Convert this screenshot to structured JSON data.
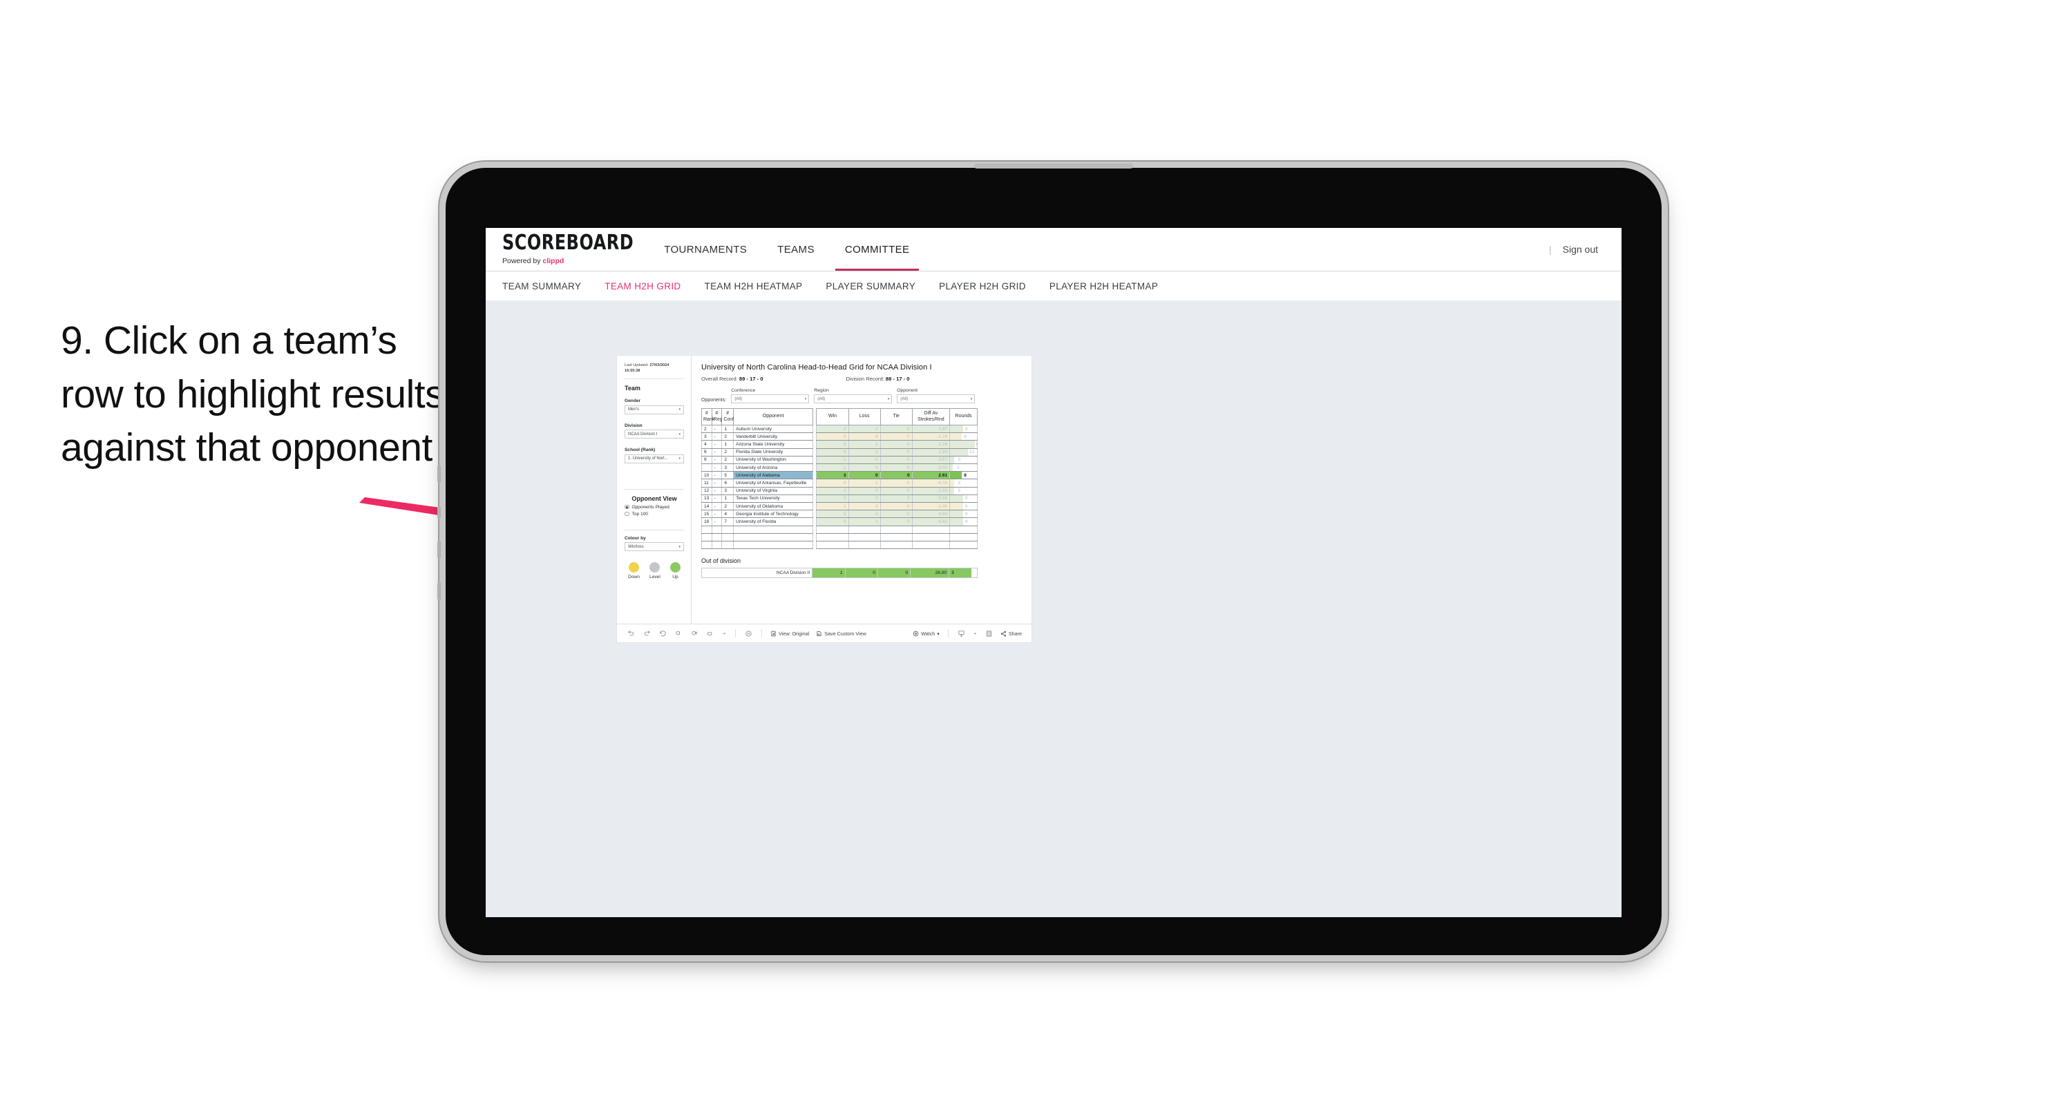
{
  "caption": {
    "text": "9. Click on a team’s row to highlight results against that opponent"
  },
  "app": {
    "brand": {
      "logo": "SCOREBOARD",
      "powered_prefix": "Powered by ",
      "powered_brand": "clippd"
    },
    "top_nav": [
      {
        "label": "TOURNAMENTS",
        "active": false
      },
      {
        "label": "TEAMS",
        "active": false
      },
      {
        "label": "COMMITTEE",
        "active": true
      }
    ],
    "sign_out": "Sign out",
    "sub_nav": [
      {
        "label": "TEAM SUMMARY",
        "active": false
      },
      {
        "label": "TEAM H2H GRID",
        "active": true
      },
      {
        "label": "TEAM H2H HEATMAP",
        "active": false
      },
      {
        "label": "PLAYER SUMMARY",
        "active": false
      },
      {
        "label": "PLAYER H2H GRID",
        "active": false
      },
      {
        "label": "PLAYER H2H HEATMAP",
        "active": false
      }
    ]
  },
  "sidebar": {
    "last_updated_label": "Last Updated: ",
    "last_updated_value": "27/03/2024 16:55:38",
    "team_heading": "Team",
    "gender": {
      "label": "Gender",
      "value": "Men’s"
    },
    "division": {
      "label": "Division",
      "value": "NCAA Division I"
    },
    "school": {
      "label": "School (Rank)",
      "value": "1. University of Nort..."
    },
    "opponent_view": {
      "heading": "Opponent View",
      "options": [
        {
          "label": "Opponents Played",
          "selected": true
        },
        {
          "label": "Top 100",
          "selected": false
        }
      ]
    },
    "colour_by": {
      "label": "Colour by",
      "value": "Win/loss"
    },
    "legend": [
      {
        "label": "Down",
        "color": "#f2d14b"
      },
      {
        "label": "Level",
        "color": "#c3c7ca"
      },
      {
        "label": "Up",
        "color": "#8bc963"
      }
    ]
  },
  "viz": {
    "title": "University of North Carolina Head-to-Head Grid for NCAA Division I",
    "overall_record_label": "Overall Record: ",
    "overall_record_value": "89 - 17 - 0",
    "division_record_label": "Division Record: ",
    "division_record_value": "88 - 17 - 0",
    "opponents_label": "Opponents:",
    "filters": [
      {
        "label": "Conference",
        "value": "(All)"
      },
      {
        "label": "Region",
        "value": "(All)"
      },
      {
        "label": "Opponent",
        "value": "(All)"
      }
    ],
    "columns": [
      "# Rank",
      "# Reg",
      "# Conf",
      "Opponent",
      "Win",
      "Loss",
      "Tie",
      "Diff Av Strokes/Rnd",
      "Rounds"
    ],
    "column_parts": {
      "rank_top": "#",
      "rank_bot": "Rank",
      "reg_top": "#",
      "reg_bot": "Reg",
      "conf_top": "#",
      "conf_bot": "Conf",
      "opponent": "Opponent",
      "win": "Win",
      "loss": "Loss",
      "tie": "Tie",
      "diff_top": "Diff Av",
      "diff_bot": "Strokes/Rnd",
      "rounds": "Rounds"
    },
    "rows": [
      {
        "rank": "2",
        "reg": "-",
        "conf": "1",
        "opponent": "Auburn University",
        "win": "2",
        "loss": "1",
        "tie": "0",
        "diff": "1.67",
        "rounds": "9",
        "rounds_pct": 48,
        "result": "win",
        "selected": false
      },
      {
        "rank": "3",
        "reg": "-",
        "conf": "2",
        "opponent": "Vanderbilt University",
        "win": "0",
        "loss": "4",
        "tie": "0",
        "diff": "-2.29",
        "rounds": "8",
        "rounds_pct": 43,
        "result": "loss",
        "selected": false
      },
      {
        "rank": "4",
        "reg": "-",
        "conf": "1",
        "opponent": "Arizona State University",
        "win": "5",
        "loss": "1",
        "tie": "0",
        "diff": "2.28",
        "rounds": "17",
        "rounds_pct": 92,
        "result": "win",
        "selected": false
      },
      {
        "rank": "6",
        "reg": "-",
        "conf": "2",
        "opponent": "Florida State University",
        "win": "4",
        "loss": "2",
        "tie": "0",
        "diff": "1.83",
        "rounds": "12",
        "rounds_pct": 66,
        "result": "win",
        "selected": false
      },
      {
        "rank": "8",
        "reg": "-",
        "conf": "2",
        "opponent": "University of Washington",
        "win": "1",
        "loss": "0",
        "tie": "0",
        "diff": "3.67",
        "rounds": "3",
        "rounds_pct": 16,
        "result": "win",
        "selected": false
      },
      {
        "rank": "",
        "reg": "-",
        "conf": "3",
        "opponent": "University of Arizona",
        "win": "1",
        "loss": "0",
        "tie": "0",
        "diff": "9.00",
        "rounds": "2",
        "rounds_pct": 11,
        "result": "win",
        "selected": false
      },
      {
        "rank": "10",
        "reg": "-",
        "conf": "5",
        "opponent": "University of Alabama",
        "win": "3",
        "loss": "0",
        "tie": "0",
        "diff": "2.61",
        "rounds": "8",
        "rounds_pct": 43,
        "result": "win",
        "selected": true
      },
      {
        "rank": "11",
        "reg": "-",
        "conf": "6",
        "opponent": "University of Arkansas, Fayetteville",
        "win": "0",
        "loss": "1",
        "tie": "0",
        "diff": "-4.33",
        "rounds": "3",
        "rounds_pct": 16,
        "result": "loss",
        "selected": false
      },
      {
        "rank": "12",
        "reg": "-",
        "conf": "3",
        "opponent": "University of Virginia",
        "win": "1",
        "loss": "0",
        "tie": "0",
        "diff": "2.33",
        "rounds": "3",
        "rounds_pct": 16,
        "result": "win",
        "selected": false
      },
      {
        "rank": "13",
        "reg": "-",
        "conf": "1",
        "opponent": "Texas Tech University",
        "win": "3",
        "loss": "0",
        "tie": "0",
        "diff": "5.56",
        "rounds": "9",
        "rounds_pct": 48,
        "result": "win",
        "selected": false
      },
      {
        "rank": "14",
        "reg": "-",
        "conf": "2",
        "opponent": "University of Oklahoma",
        "win": "1",
        "loss": "2",
        "tie": "0",
        "diff": "-1.00",
        "rounds": "9",
        "rounds_pct": 48,
        "result": "loss",
        "selected": false
      },
      {
        "rank": "15",
        "reg": "-",
        "conf": "4",
        "opponent": "Georgia Institute of Technology",
        "win": "5",
        "loss": "0",
        "tie": "0",
        "diff": "4.50",
        "rounds": "9",
        "rounds_pct": 48,
        "result": "win",
        "selected": false
      },
      {
        "rank": "16",
        "reg": "-",
        "conf": "7",
        "opponent": "University of Florida",
        "win": "3",
        "loss": "1",
        "tie": "0",
        "diff": "6.62",
        "rounds": "9",
        "rounds_pct": 48,
        "result": "win",
        "selected": false
      }
    ],
    "out_of_division": {
      "heading": "Out of division",
      "row": {
        "label": "NCAA Division II",
        "win": "1",
        "loss": "0",
        "tie": "0",
        "diff": "26.00",
        "rounds": "3",
        "rounds_pct": 80
      }
    }
  },
  "footer": {
    "view_label": "View: Original",
    "save_label": "Save Custom View",
    "watch_label": "Watch",
    "share_label": "Share"
  }
}
